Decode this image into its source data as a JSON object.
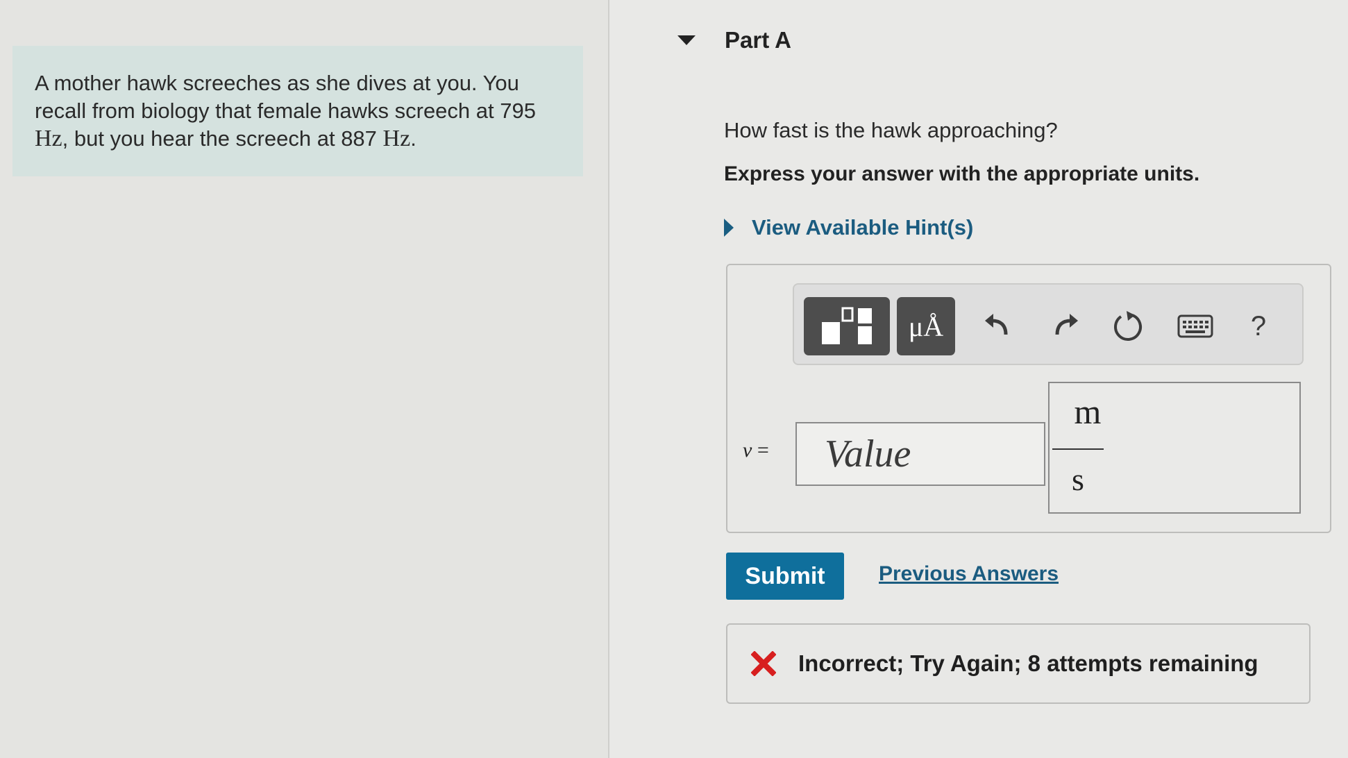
{
  "problem": {
    "text_1": "A mother hawk screeches as she dives at you. You recall from biology that female hawks screech at ",
    "freq_1_value": "795",
    "freq_unit": "Hz",
    "text_2": ", but you hear the screech at ",
    "freq_2_value": "887",
    "text_3": "."
  },
  "part": {
    "title": "Part A"
  },
  "question": "How fast is the hawk approaching?",
  "instruction": "Express your answer with the appropriate units.",
  "hint_link": "View Available Hint(s)",
  "toolbar": {
    "units_button": "μÅ",
    "help_label": "?"
  },
  "answer": {
    "variable": "v",
    "equals": " =",
    "value_placeholder": "Value",
    "unit_numerator": "m",
    "unit_denominator": "s"
  },
  "actions": {
    "submit_label": "Submit",
    "previous_answers_label": "Previous Answers"
  },
  "feedback": {
    "message": "Incorrect; Try Again; 8 attempts remaining"
  },
  "colors": {
    "accent": "#0f6f9c",
    "link": "#1b5c80",
    "problem_bg": "#d5e2df",
    "error": "#d71f1f"
  }
}
